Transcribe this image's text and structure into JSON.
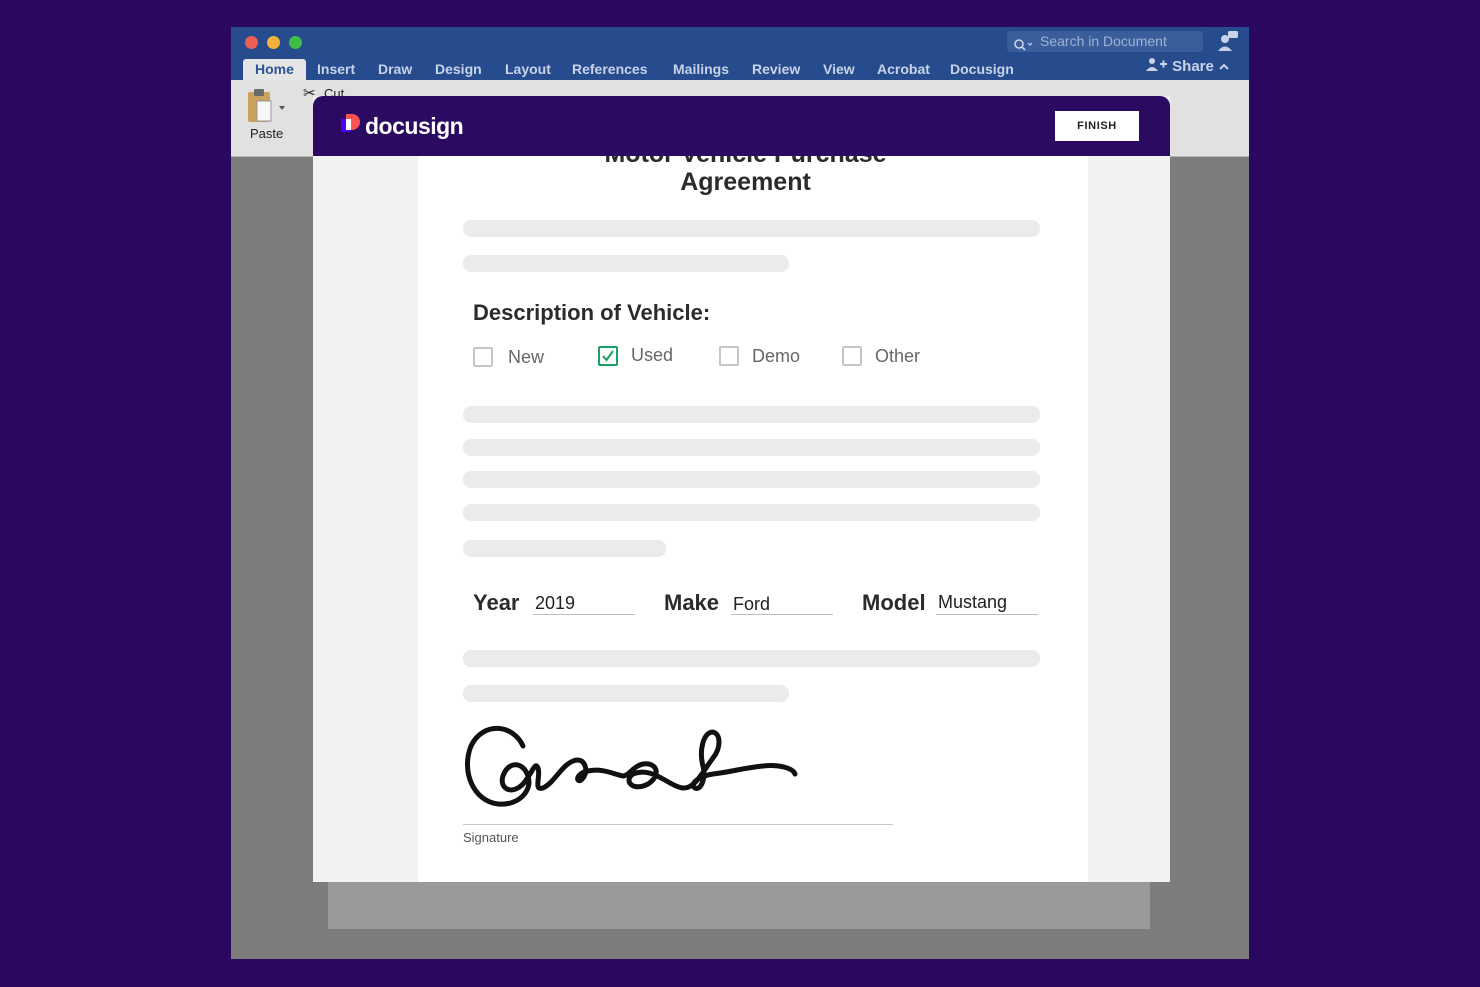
{
  "word": {
    "search_placeholder": "Search in Document",
    "tabs": [
      "Home",
      "Insert",
      "Draw",
      "Design",
      "Layout",
      "References",
      "Mailings",
      "Review",
      "View",
      "Acrobat",
      "Docusign"
    ],
    "share_label": "Share",
    "ribbon": {
      "paste_label": "Paste",
      "cut_label": "Cut"
    },
    "traffic_lights": [
      "#ec5f56",
      "#f4b13e",
      "#3fbd48"
    ]
  },
  "docusign": {
    "brand": "docusign",
    "finish_label": "FINISH",
    "colors": {
      "header": "#2a0b61",
      "check": "#19a15f"
    }
  },
  "document": {
    "title_line1": "Motor Vehicle Purchase",
    "title_line2": "Agreement",
    "description_heading": "Description of Vehicle:",
    "options": [
      {
        "label": "New",
        "checked": false
      },
      {
        "label": "Used",
        "checked": true
      },
      {
        "label": "Demo",
        "checked": false
      },
      {
        "label": "Other",
        "checked": false
      }
    ],
    "fields": {
      "year": {
        "label": "Year",
        "value": "2019"
      },
      "make": {
        "label": "Make",
        "value": "Ford"
      },
      "model": {
        "label": "Model",
        "value": "Mustang"
      }
    },
    "signature_label": "Signature"
  }
}
